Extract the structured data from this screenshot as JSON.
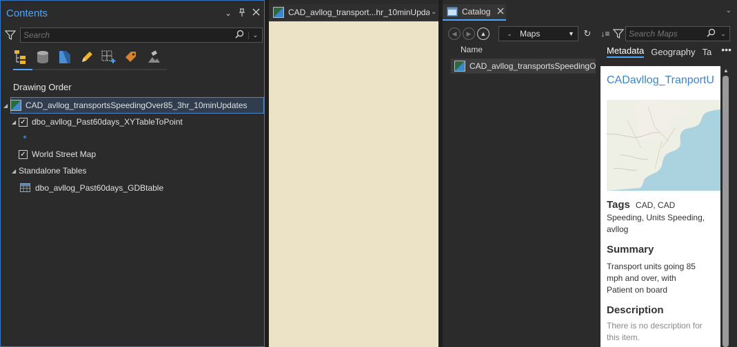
{
  "contents": {
    "title": "Contents",
    "search_placeholder": "Search",
    "drawing_order": "Drawing Order",
    "map_name": "CAD_avllog_transportsSpeedingOver85_3hr_10minUpdates",
    "layer": "dbo_avllog_Past60days_XYTableToPoint",
    "basemap": "World Street Map",
    "standalone_tables": "Standalone Tables",
    "table": "dbo_avllog_Past60days_GDBtable"
  },
  "mapview": {
    "tab_label": "CAD_avllog_transport...hr_10minUpda"
  },
  "catalog": {
    "tab_label": "Catalog",
    "location": "Maps",
    "search_placeholder": "Search Maps",
    "name_header": "Name",
    "item": "CAD_avllog_transportsSpeedingOv",
    "tabs": [
      "Metadata",
      "Geography",
      "Ta"
    ],
    "metadata": {
      "title": "CADavllog_TranportU",
      "tags_label": "Tags",
      "tags_value_1": "CAD, CAD",
      "tags_value_2": "Speeding, Units Speeding,",
      "tags_value_3": "avllog",
      "summary_label": "Summary",
      "summary_1": "Transport units going 85",
      "summary_2": "mph and over, with",
      "summary_3": "Patient on board",
      "description_label": "Description",
      "description_1": "There is no description for",
      "description_2": "this item."
    }
  },
  "colors": {
    "accent": "#4ea6ff",
    "map_canvas": "#ece3c7",
    "panel": "#2b2b2b"
  }
}
